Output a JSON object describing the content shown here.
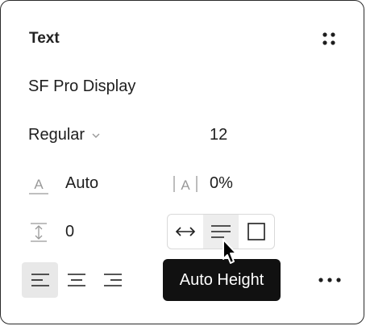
{
  "panel": {
    "title": "Text",
    "font_family": "SF Pro Display",
    "font_weight": "Regular",
    "font_size": "12",
    "line_height": "Auto",
    "letter_spacing": "0%",
    "paragraph_spacing": "0"
  },
  "resizing": {
    "options": [
      "Auto Width",
      "Auto Height",
      "Fixed Size"
    ],
    "selected": "Auto Height",
    "tooltip": "Auto Height"
  },
  "alignment": {
    "options": [
      "Align left",
      "Align center",
      "Align right"
    ],
    "selected": "Align left"
  },
  "icons": {
    "styles": "four-dots-icon",
    "weight_dropdown": "chevron-down-icon",
    "line_height": "line-height-icon",
    "letter_spacing": "letter-spacing-icon",
    "paragraph_spacing": "paragraph-spacing-icon",
    "auto_width": "arrows-horizontal-icon",
    "auto_height": "lines-icon",
    "fixed_size": "square-icon",
    "more": "more-dots-icon",
    "cursor": "pointer-cursor-icon"
  },
  "colors": {
    "text": "#1e1e1e",
    "icon_gray": "#999999",
    "tooltip_bg": "#111111",
    "active_bg": "#ededed"
  }
}
